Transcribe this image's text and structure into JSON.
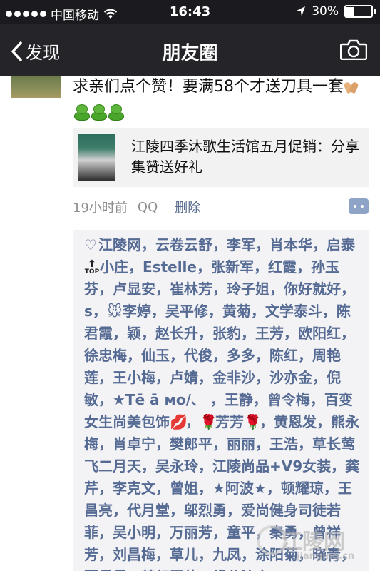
{
  "status_bar": {
    "carrier": "中国移动",
    "time": "16:43",
    "battery_percent": "30%",
    "battery_level": 0.3,
    "signal_icon": "signal-dots-icon",
    "wifi_icon": "wifi-icon",
    "location_icon": "location-arrow-icon"
  },
  "nav": {
    "back_label": "发现",
    "title": "朋友圈",
    "camera_icon": "camera-icon"
  },
  "post": {
    "text_main": "求亲们点个赞！要满58个才送刀具一套",
    "share": {
      "title": "江陵四季沐歌生活馆五月促销：分享集赞送好礼"
    },
    "meta": {
      "time": "19小时前",
      "source": "QQ",
      "delete_label": "删除"
    }
  },
  "likes": {
    "part1": "江陵网，云卷云舒，李军，肖本华，启泰",
    "top_badge": "TOP",
    "part2": "小庄，Estelle，张新军，红霞，孙玉芬，卢显安，崔林芳，玲子姐，你好就好，s，",
    "part3": "李婷，吴平修，黄菊，文学泰斗，陈君霞，颖，赵长升，张豹，王芳，欧阳红，徐忠梅，仙玉，代俊，多多，陈红，周艳莲，王小梅，卢婧，金非沙，沙亦金，倪敏，★Tē ā мо/、 ，王静，曾令梅，百变女生尚美包饰",
    "part4": "，",
    "part5": "芳芳",
    "part6": "，黄恩发，熊永梅，肖卓宁，樊郎平，丽丽，王浩，草长莺飞二月天，吴永玲，江陵尚品+V9女装，龚芹，李克文，曾姐，★阿波★，顿耀琼，王昌亮，代月堂，邬烈勇，爱尚健身司徒若菲，吴小明，万丽芳，童平，秦勇，曾祥芳，刘昌梅，草儿，九凤，涂阳菊，晓青，鄢兵兵，梦幻天使，缘分注定"
  },
  "watermark": {
    "cn": "江陵网",
    "en": "jianging.cn"
  },
  "colors": {
    "status_bar": "#1b1b1f",
    "nav_bar": "#252529",
    "link_blue": "#566b94",
    "meta_gray": "#8e8e8e",
    "card_bg": "#f2f2f2"
  }
}
